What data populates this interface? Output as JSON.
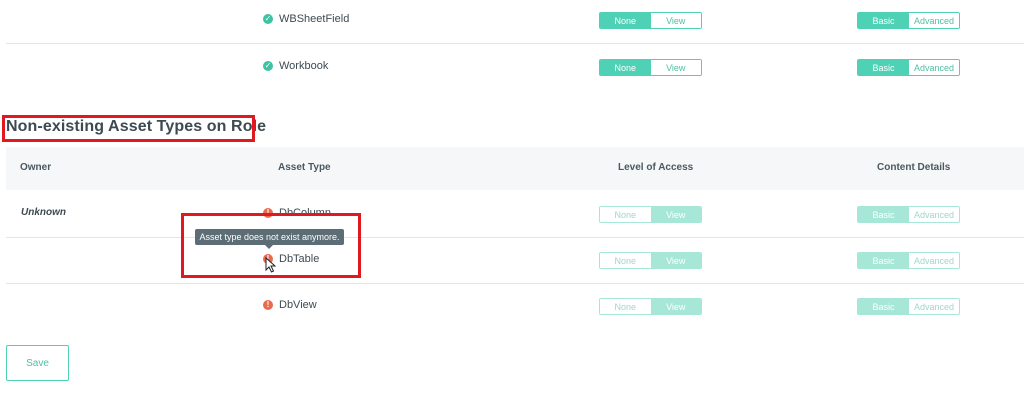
{
  "existing_rows": [
    {
      "asset": "WBSheetField",
      "access_options": [
        "None",
        "View"
      ],
      "access_selected": "None",
      "content_options": [
        "Basic",
        "Advanced"
      ],
      "content_selected": "Basic"
    },
    {
      "asset": "Workbook",
      "access_options": [
        "None",
        "View"
      ],
      "access_selected": "None",
      "content_options": [
        "Basic",
        "Advanced"
      ],
      "content_selected": "Basic"
    }
  ],
  "section": {
    "title": "Non-existing Asset Types on Role"
  },
  "table": {
    "headers": {
      "owner": "Owner",
      "asset_type": "Asset Type",
      "level_of_access": "Level of Access",
      "content_details": "Content Details"
    },
    "rows": [
      {
        "owner": "Unknown",
        "asset": "DbColumn",
        "access_options": [
          "None",
          "View"
        ],
        "access_selected": "View",
        "content_options": [
          "Basic",
          "Advanced"
        ],
        "content_selected": "Basic"
      },
      {
        "owner": "",
        "asset": "DbTable",
        "access_options": [
          "None",
          "View"
        ],
        "access_selected": "View",
        "content_options": [
          "Basic",
          "Advanced"
        ],
        "content_selected": "Basic"
      },
      {
        "owner": "",
        "asset": "DbView",
        "access_options": [
          "None",
          "View"
        ],
        "access_selected": "View",
        "content_options": [
          "Basic",
          "Advanced"
        ],
        "content_selected": "Basic"
      }
    ]
  },
  "tooltip": {
    "text": "Asset type does not exist anymore."
  },
  "save_label": "Save",
  "icons": {
    "ok": "check-circle-icon",
    "error": "exclamation-circle-icon",
    "cursor": "mouse-pointer-icon"
  },
  "colors": {
    "accent": "#4fd1b5",
    "error": "#ea6a4f",
    "highlight": "#e0181f"
  }
}
